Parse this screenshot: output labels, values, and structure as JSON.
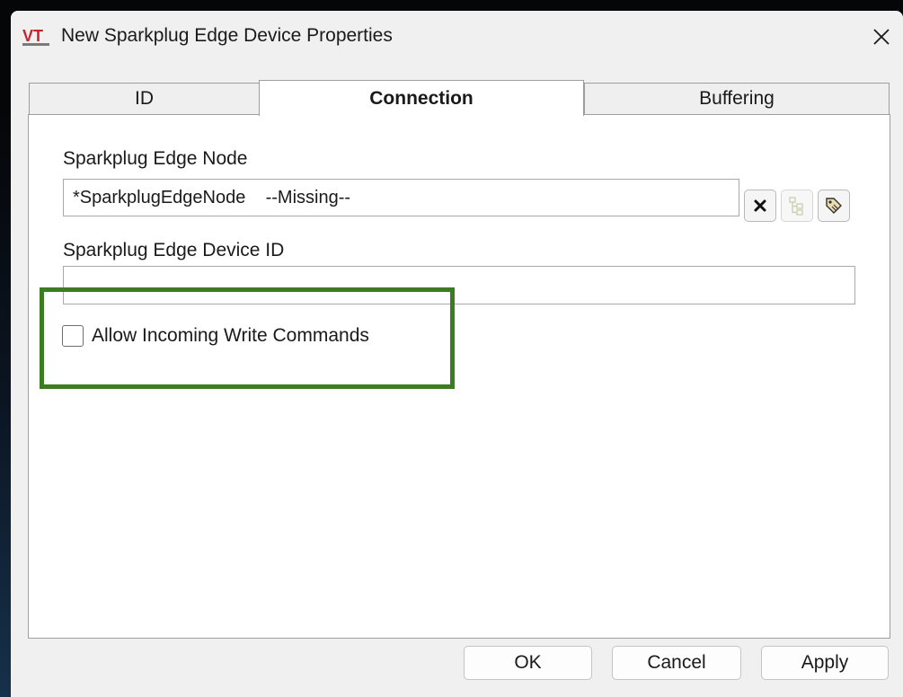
{
  "window": {
    "title": "New Sparkplug Edge Device Properties",
    "icon": "vtscada-logo",
    "close_icon": "close-icon"
  },
  "tabs": [
    {
      "label": "ID",
      "active": false
    },
    {
      "label": "Connection",
      "active": true
    },
    {
      "label": "Buffering",
      "active": false
    }
  ],
  "connection": {
    "edge_node_label": "Sparkplug Edge Node",
    "edge_node_value": "*SparkplugEdgeNode    --Missing--",
    "edge_node_buttons": [
      "clear-icon",
      "tag-browser-icon",
      "tag-properties-icon"
    ],
    "device_id_label": "Sparkplug Edge Device ID",
    "device_id_value": "",
    "allow_write_label": "Allow Incoming Write Commands",
    "allow_write_checked": false
  },
  "buttons": {
    "ok": "OK",
    "cancel": "Cancel",
    "apply": "Apply"
  },
  "colors": {
    "highlight": "#3c7d23",
    "logo_red": "#c4262e"
  }
}
